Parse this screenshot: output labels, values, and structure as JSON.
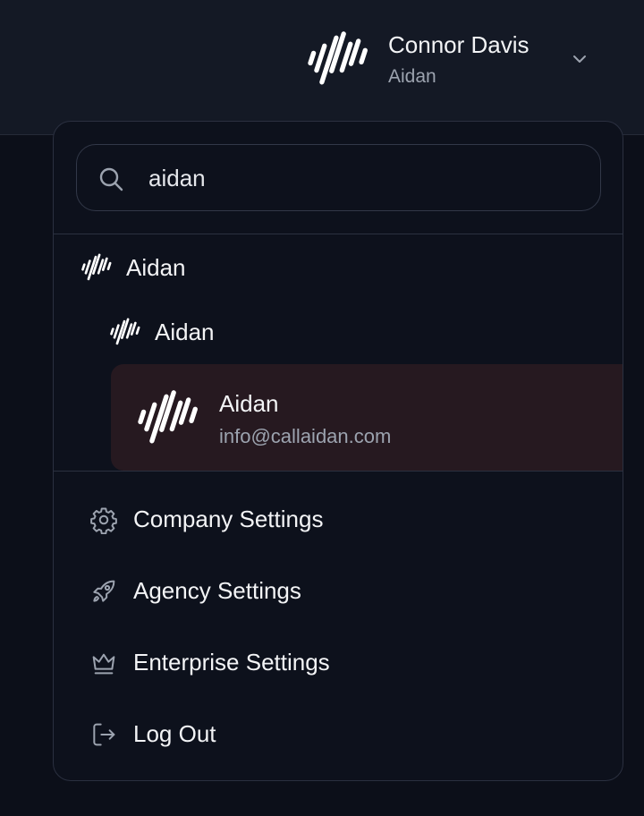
{
  "header": {
    "user_name": "Connor Davis",
    "current_org": "Aidan"
  },
  "search": {
    "value": "aidan",
    "placeholder": ""
  },
  "org_tree": {
    "level1_label": "Aidan",
    "level2_label": "Aidan",
    "selected": {
      "name": "Aidan",
      "email": "info@callaidan.com"
    }
  },
  "menu": [
    {
      "label": "Company Settings",
      "icon": "gear-icon"
    },
    {
      "label": "Agency Settings",
      "icon": "rocket-icon"
    },
    {
      "label": "Enterprise Settings",
      "icon": "crown-icon"
    },
    {
      "label": "Log Out",
      "icon": "logout-icon"
    }
  ],
  "colors": {
    "background": "#0c0f19",
    "topbar": "#141925",
    "dropdown": "#0d111c",
    "selected_row": "#261920",
    "text_primary": "#f3f4f6",
    "text_secondary": "#9ca3af"
  }
}
